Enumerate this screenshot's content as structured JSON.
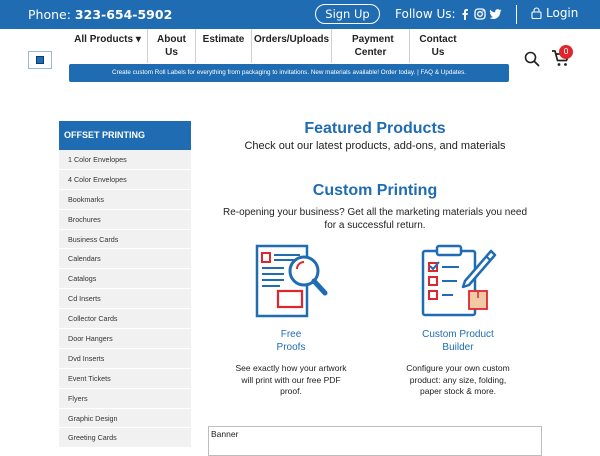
{
  "topbar": {
    "phone_label": "Phone:",
    "phone_number": "323-654-5902",
    "signup_label": "Sign Up",
    "follow_label": "Follow Us:",
    "social_icons": [
      "facebook-icon",
      "instagram-icon",
      "twitter-icon"
    ],
    "login_label": "Login"
  },
  "nav": {
    "items": [
      {
        "label": "All Products ▾"
      },
      {
        "label": "About Us"
      },
      {
        "label": "Estimate"
      },
      {
        "label": "Orders/Uploads"
      },
      {
        "label": "Payment Center"
      },
      {
        "label": "Contact Us"
      }
    ],
    "promo": "Create custom Roll Labels for everything from packaging to invitations. New materials available! Order today. | FAQ & Updates.",
    "cart_count": "0"
  },
  "sidebar": {
    "heading": "OFFSET PRINTING",
    "items": [
      "1 Color Envelopes",
      "4 Color Envelopes",
      "Bookmarks",
      "Brochures",
      "Business Cards",
      "Calendars",
      "Catalogs",
      "Cd Inserts",
      "Collector Cards",
      "Door Hangers",
      "Dvd Inserts",
      "Event Tickets",
      "Flyers",
      "Graphic Design",
      "Greeting Cards"
    ]
  },
  "main": {
    "featured_title": "Featured Products",
    "featured_subtitle": "Check out our latest products, add-ons, and materials",
    "custom_title": "Custom Printing",
    "custom_subtitle": "Re-opening your business? Get all the marketing materials you need for a successful return.",
    "features": [
      {
        "title_line1": "Free",
        "title_line2": "Proofs",
        "description": "See exactly how your artwork will print with our free PDF proof.",
        "icon": "proof-magnifier-icon"
      },
      {
        "title_line1": "Custom Product",
        "title_line2": "Builder",
        "description": "Configure your own custom product: any size, folding, paper stock & more.",
        "icon": "clipboard-pencil-icon"
      }
    ],
    "banner_label": "Banner"
  },
  "colors": {
    "primary": "#1f6cb3",
    "accent": "#e0262d",
    "sidebar_bg": "#f1f1f1"
  }
}
